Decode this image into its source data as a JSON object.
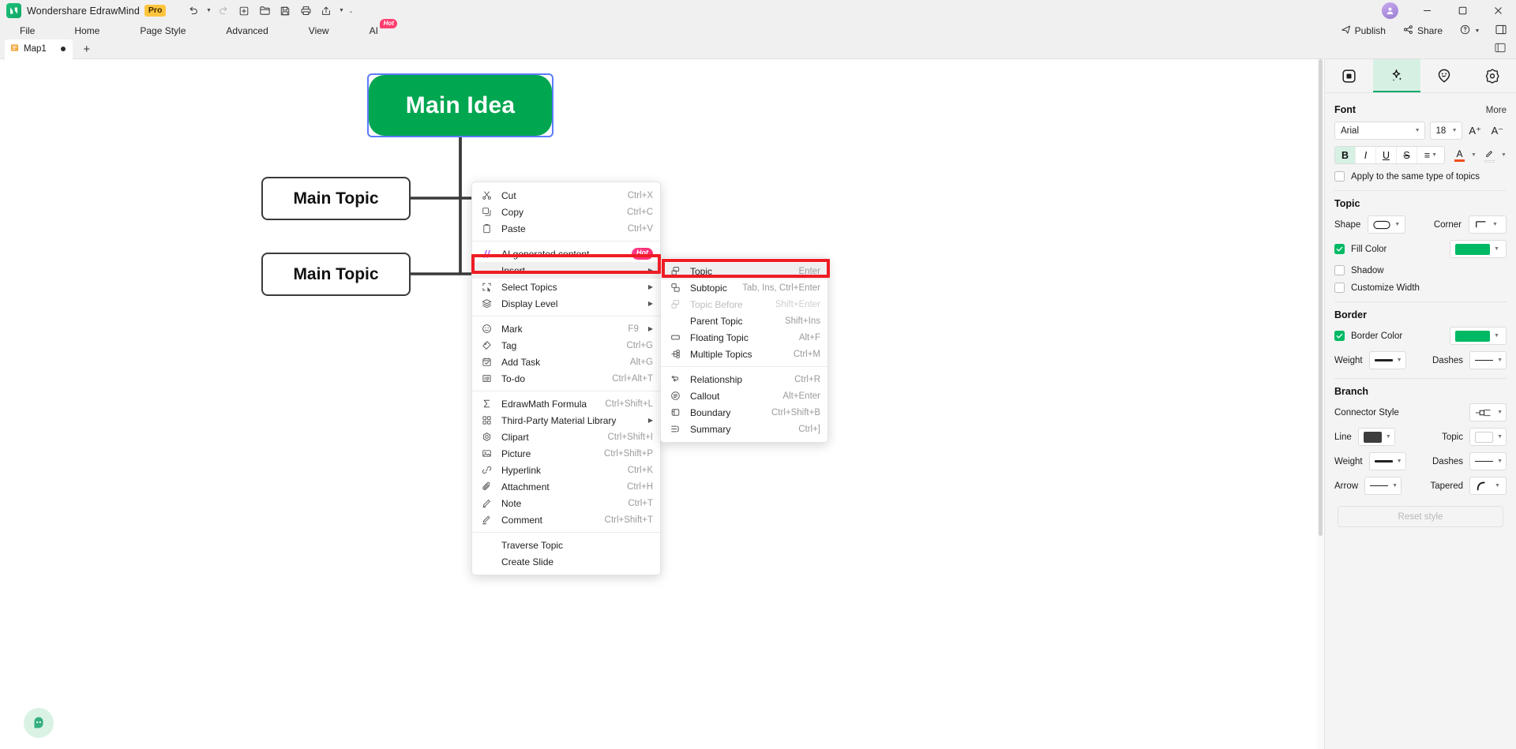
{
  "titlebar": {
    "app_name": "Wondershare EdrawMind",
    "pro_badge": "Pro",
    "tools": [
      {
        "name": "undo-button",
        "glyph": "↶"
      },
      {
        "name": "redo-button",
        "glyph": "↷"
      },
      {
        "name": "new-button",
        "glyph": "＋"
      },
      {
        "name": "open-button",
        "glyph": "🗁"
      },
      {
        "name": "save-button",
        "glyph": "💾"
      },
      {
        "name": "print-button",
        "glyph": "🖨"
      },
      {
        "name": "export-button",
        "glyph": "↗"
      }
    ],
    "publish_label": "Publish",
    "share_label": "Share",
    "help_label": "?",
    "window_controls": {
      "minimize": "─",
      "maximize": "❐",
      "close": "✕"
    }
  },
  "menubar": {
    "items": [
      "File",
      "Home",
      "Page Style",
      "Advanced",
      "View",
      "AI"
    ],
    "ai_badge": "Hot"
  },
  "tabstrip": {
    "document_name": "Map1",
    "add_tab_label": "+"
  },
  "canvas": {
    "nodes": [
      {
        "name": "main-idea-node",
        "text": "Main Idea"
      },
      {
        "name": "main-topic-node-1",
        "text": "Main Topic"
      },
      {
        "name": "main-topic-node-2",
        "text": "Main Topic"
      }
    ]
  },
  "context_menu": {
    "groups": [
      [
        {
          "label": "Cut",
          "shortcut": "Ctrl+X",
          "icon": "scissors-icon",
          "glyph": "✂",
          "submenu": false,
          "disabled": false
        },
        {
          "label": "Copy",
          "shortcut": "Ctrl+C",
          "icon": "copy-icon",
          "glyph": "❐",
          "submenu": false,
          "disabled": false
        },
        {
          "label": "Paste",
          "shortcut": "Ctrl+V",
          "icon": "clipboard-icon",
          "glyph": "📋",
          "submenu": false,
          "disabled": false
        }
      ],
      [
        {
          "label": "AI generated content",
          "shortcut": "",
          "icon": "ai-sparkle-icon",
          "glyph": "",
          "submenu": false,
          "disabled": false,
          "badge": "Hot"
        },
        {
          "label": "Insert",
          "shortcut": "",
          "icon": "none",
          "glyph": "",
          "submenu": true,
          "disabled": false,
          "highlighted": true
        },
        {
          "label": "Select Topics",
          "shortcut": "",
          "icon": "select-topics-icon",
          "glyph": "⬚",
          "submenu": true,
          "disabled": false
        },
        {
          "label": "Display Level",
          "shortcut": "",
          "icon": "layers-icon",
          "glyph": "☰",
          "submenu": true,
          "disabled": false
        }
      ],
      [
        {
          "label": "Mark",
          "shortcut": "F9",
          "icon": "mark-icon",
          "glyph": "☺",
          "submenu": true,
          "disabled": false
        },
        {
          "label": "Tag",
          "shortcut": "Ctrl+G",
          "icon": "tag-icon",
          "glyph": "◇",
          "submenu": false,
          "disabled": false
        },
        {
          "label": "Add Task",
          "shortcut": "Alt+G",
          "icon": "calendar-check-icon",
          "glyph": "🗓",
          "submenu": false,
          "disabled": false
        },
        {
          "label": "To-do",
          "shortcut": "Ctrl+Alt+T",
          "icon": "todo-list-icon",
          "glyph": "☰",
          "submenu": false,
          "disabled": false
        }
      ],
      [
        {
          "label": "EdrawMath Formula",
          "shortcut": "Ctrl+Shift+L",
          "icon": "sigma-icon",
          "glyph": "Σ",
          "submenu": false,
          "disabled": false
        },
        {
          "label": "Third-Party Material Library",
          "shortcut": "",
          "icon": "grid-icon",
          "glyph": "░",
          "submenu": true,
          "disabled": false
        },
        {
          "label": "Clipart",
          "shortcut": "Ctrl+Shift+I",
          "icon": "clipart-icon",
          "glyph": "❁",
          "submenu": false,
          "disabled": false
        },
        {
          "label": "Picture",
          "shortcut": "Ctrl+Shift+P",
          "icon": "picture-icon",
          "glyph": "🖼",
          "submenu": false,
          "disabled": false
        },
        {
          "label": "Hyperlink",
          "shortcut": "Ctrl+K",
          "icon": "link-icon",
          "glyph": "🔗",
          "submenu": false,
          "disabled": false
        },
        {
          "label": "Attachment",
          "shortcut": "Ctrl+H",
          "icon": "paperclip-icon",
          "glyph": "📎",
          "submenu": false,
          "disabled": false
        },
        {
          "label": "Note",
          "shortcut": "Ctrl+T",
          "icon": "pencil-icon",
          "glyph": "✎",
          "submenu": false,
          "disabled": false
        },
        {
          "label": "Comment",
          "shortcut": "Ctrl+Shift+T",
          "icon": "comment-pencil-icon",
          "glyph": "✎",
          "submenu": false,
          "disabled": false
        }
      ],
      [
        {
          "label": "Traverse Topic",
          "shortcut": "",
          "icon": "none",
          "glyph": "",
          "submenu": false,
          "disabled": false
        },
        {
          "label": "Create Slide",
          "shortcut": "",
          "icon": "none",
          "glyph": "",
          "submenu": false,
          "disabled": false
        }
      ]
    ]
  },
  "insert_submenu": {
    "groups": [
      [
        {
          "label": "Topic",
          "shortcut": "Enter",
          "icon": "topic-icon",
          "disabled": false,
          "highlighted": true
        },
        {
          "label": "Subtopic",
          "shortcut": "Tab, Ins, Ctrl+Enter",
          "icon": "subtopic-icon",
          "disabled": false
        },
        {
          "label": "Topic Before",
          "shortcut": "Shift+Enter",
          "icon": "topic-before-icon",
          "disabled": true
        },
        {
          "label": "Parent Topic",
          "shortcut": "Shift+Ins",
          "icon": "none",
          "disabled": false
        },
        {
          "label": "Floating Topic",
          "shortcut": "Alt+F",
          "icon": "floating-topic-icon",
          "disabled": false
        },
        {
          "label": "Multiple Topics",
          "shortcut": "Ctrl+M",
          "icon": "multiple-topics-icon",
          "disabled": false
        }
      ],
      [
        {
          "label": "Relationship",
          "shortcut": "Ctrl+R",
          "icon": "relationship-icon",
          "disabled": false
        },
        {
          "label": "Callout",
          "shortcut": "Alt+Enter",
          "icon": "callout-icon",
          "disabled": false
        },
        {
          "label": "Boundary",
          "shortcut": "Ctrl+Shift+B",
          "icon": "boundary-icon",
          "disabled": false
        },
        {
          "label": "Summary",
          "shortcut": "Ctrl+]",
          "icon": "summary-icon",
          "disabled": false
        }
      ]
    ]
  },
  "right_panel": {
    "tabs": [
      {
        "name": "page-tab",
        "icon": "square-inset-icon",
        "active": false
      },
      {
        "name": "style-tab",
        "icon": "sparkle-icon",
        "active": true
      },
      {
        "name": "icon-tab",
        "icon": "smiley-pin-icon",
        "active": false
      },
      {
        "name": "settings-tab",
        "icon": "gear-flower-icon",
        "active": false
      }
    ],
    "font": {
      "title": "Font",
      "more": "More",
      "family": "Arial",
      "size": "18",
      "increase_label": "A⁺",
      "decrease_label": "A⁻",
      "bold": "B",
      "italic": "I",
      "underline": "U",
      "strikethrough": "S",
      "align": "≡",
      "font_color_label": "A",
      "font_color": "#f04b1e",
      "highlight_label": "✎",
      "apply_same_type_label": "Apply to the same type of topics",
      "apply_same_type_checked": false
    },
    "topic": {
      "title": "Topic",
      "shape_label": "Shape",
      "corner_label": "Corner",
      "fill_color_label": "Fill Color",
      "fill_color_checked": true,
      "fill_color": "#00b964",
      "shadow_label": "Shadow",
      "shadow_checked": false,
      "customize_width_label": "Customize Width",
      "customize_width_checked": false
    },
    "border": {
      "title": "Border",
      "border_color_label": "Border Color",
      "border_color_checked": true,
      "border_color": "#00b964",
      "weight_label": "Weight",
      "dashes_label": "Dashes"
    },
    "branch": {
      "title": "Branch",
      "connector_style_label": "Connector Style",
      "line_label": "Line",
      "line_color": "#3d3d3d",
      "topic_label": "Topic",
      "topic_color": "#ffffff",
      "weight_label": "Weight",
      "dashes_label": "Dashes",
      "arrow_label": "Arrow",
      "tapered_label": "Tapered",
      "reset_label": "Reset style"
    }
  }
}
